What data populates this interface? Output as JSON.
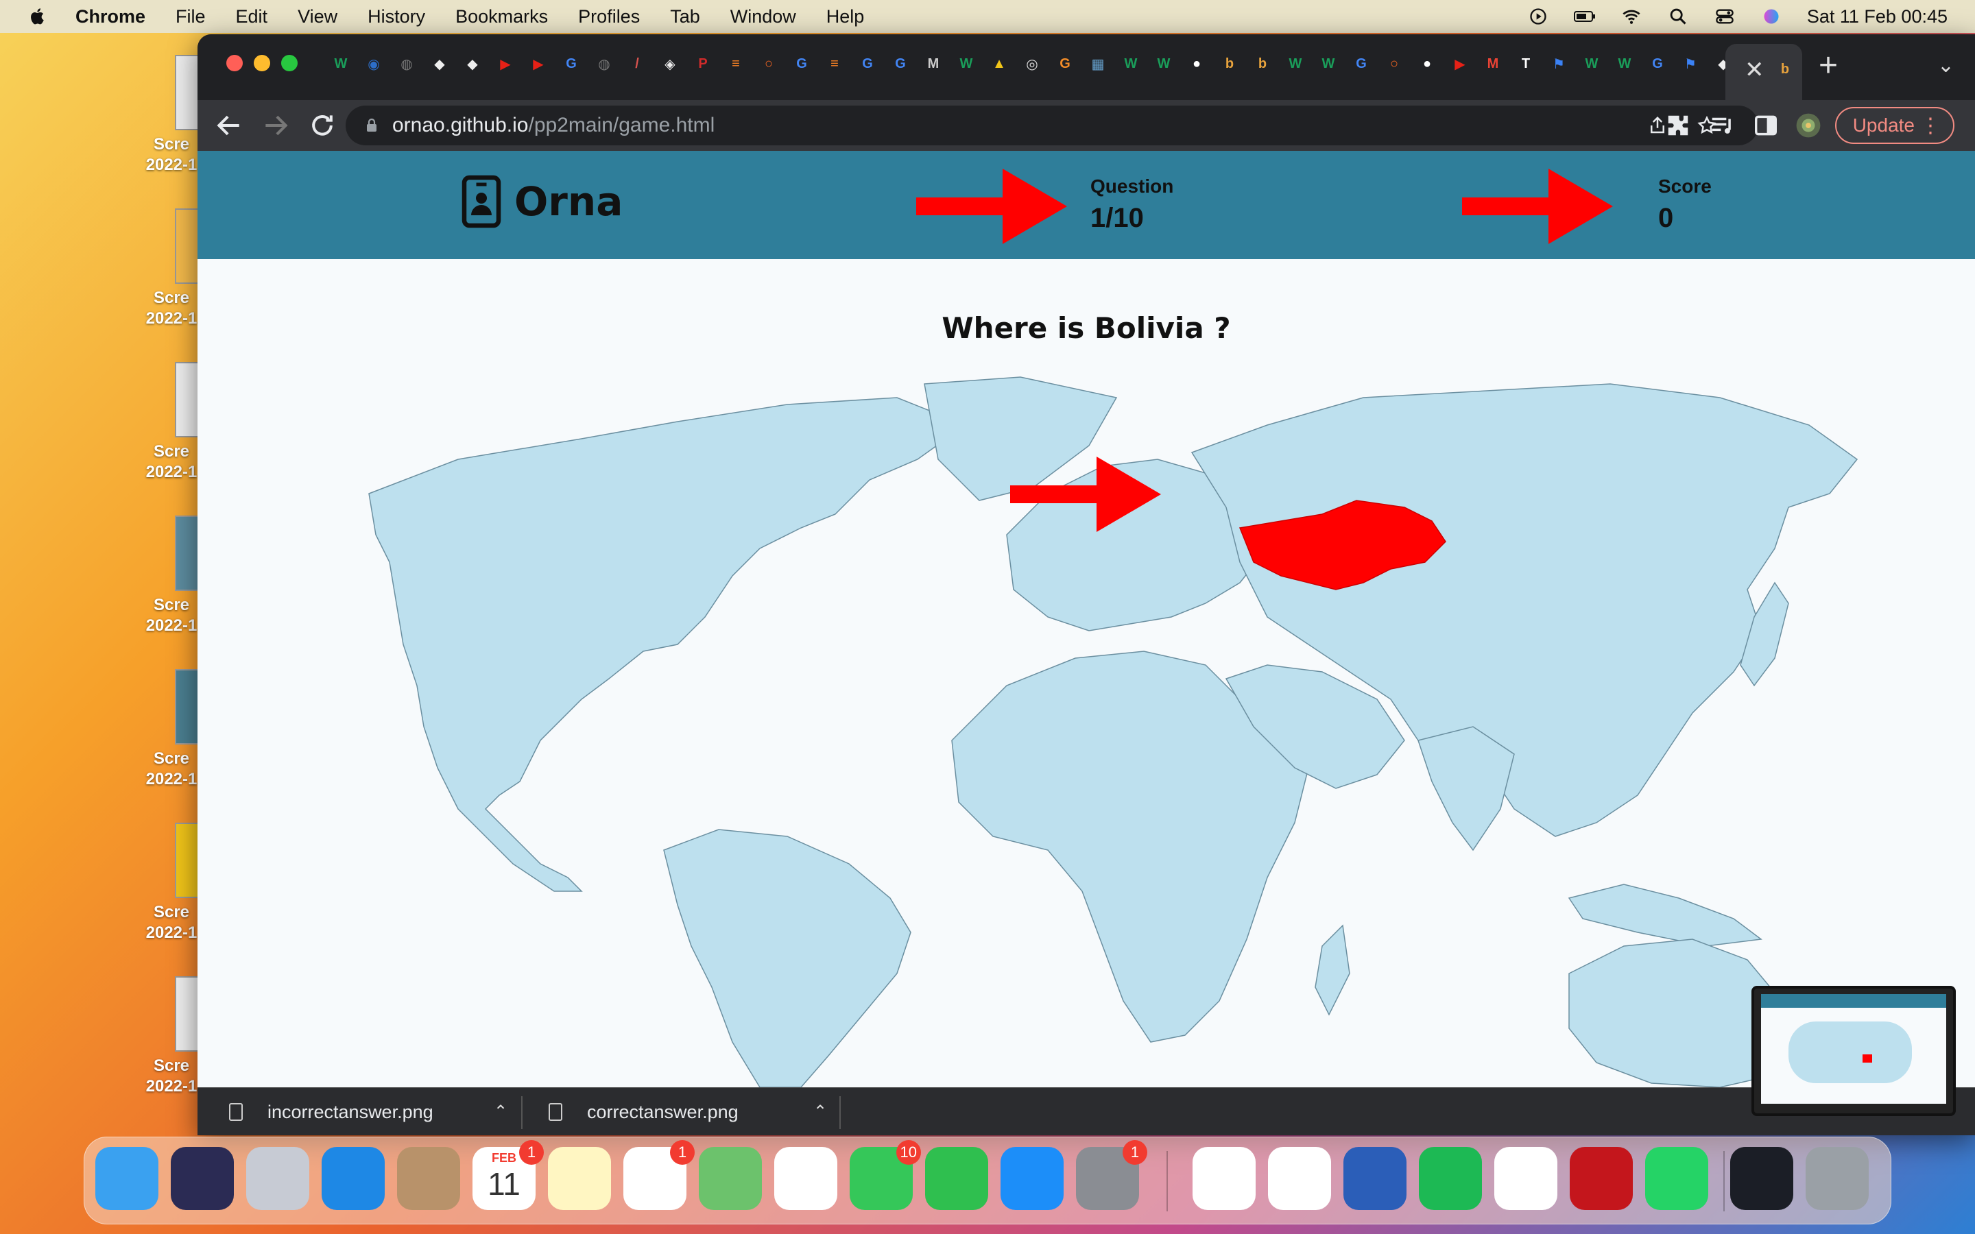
{
  "menubar": {
    "app_name": "Chrome",
    "items": [
      "File",
      "Edit",
      "View",
      "History",
      "Bookmarks",
      "Profiles",
      "Tab",
      "Window",
      "Help"
    ],
    "clock": "Sat 11 Feb  00:45"
  },
  "desktop": {
    "items": [
      {
        "label": "Scre",
        "sublabel": "2022-1"
      },
      {
        "label": "Scre",
        "sublabel": "2022-1"
      },
      {
        "label": "Scre",
        "sublabel": "2022-1"
      },
      {
        "label": "Scre",
        "sublabel": "2022-1"
      },
      {
        "label": "Scre",
        "sublabel": "2022-1"
      },
      {
        "label": "Scre",
        "sublabel": "2022-1"
      },
      {
        "label": "Scre",
        "sublabel": "2022-1"
      }
    ]
  },
  "browser": {
    "tab_favicons": [
      {
        "glyph": "W",
        "color": "#1a9e5a"
      },
      {
        "glyph": "◉",
        "color": "#2d6ec8"
      },
      {
        "glyph": "◍",
        "color": "#777777"
      },
      {
        "glyph": "◆",
        "color": "#eeeeee"
      },
      {
        "glyph": "◆",
        "color": "#eeeeee"
      },
      {
        "glyph": "▶",
        "color": "#e62117"
      },
      {
        "glyph": "▶",
        "color": "#e62117"
      },
      {
        "glyph": "G",
        "color": "#4285f4"
      },
      {
        "glyph": "◍",
        "color": "#777777"
      },
      {
        "glyph": "/",
        "color": "#d9534f"
      },
      {
        "glyph": "◈",
        "color": "#eeeeee"
      },
      {
        "glyph": "P",
        "color": "#d02b2b"
      },
      {
        "glyph": "≡",
        "color": "#f48024"
      },
      {
        "glyph": "○",
        "color": "#f26522"
      },
      {
        "glyph": "G",
        "color": "#4285f4"
      },
      {
        "glyph": "≡",
        "color": "#f48024"
      },
      {
        "glyph": "G",
        "color": "#4285f4"
      },
      {
        "glyph": "G",
        "color": "#4285f4"
      },
      {
        "glyph": "M",
        "color": "#cccccc"
      },
      {
        "glyph": "W",
        "color": "#1a9e5a"
      },
      {
        "glyph": "▲",
        "color": "#f0c419"
      },
      {
        "glyph": "◎",
        "color": "#dddddd"
      },
      {
        "glyph": "G",
        "color": "#f28c28"
      },
      {
        "glyph": "▦",
        "color": "#6aa9d8"
      },
      {
        "glyph": "W",
        "color": "#1a9e5a"
      },
      {
        "glyph": "W",
        "color": "#1a9e5a"
      },
      {
        "glyph": "●",
        "color": "#ffffff"
      },
      {
        "glyph": "b",
        "color": "#e8a33d"
      },
      {
        "glyph": "b",
        "color": "#e8a33d"
      },
      {
        "glyph": "W",
        "color": "#1a9e5a"
      },
      {
        "glyph": "W",
        "color": "#1a9e5a"
      },
      {
        "glyph": "G",
        "color": "#4285f4"
      },
      {
        "glyph": "○",
        "color": "#f26522"
      },
      {
        "glyph": "●",
        "color": "#ffffff"
      },
      {
        "glyph": "▶",
        "color": "#e62117"
      },
      {
        "glyph": "M",
        "color": "#ea4335"
      },
      {
        "glyph": "T",
        "color": "#ffffff"
      },
      {
        "glyph": "⚑",
        "color": "#3b82f6"
      },
      {
        "glyph": "W",
        "color": "#1a9e5a"
      },
      {
        "glyph": "W",
        "color": "#1a9e5a"
      },
      {
        "glyph": "G",
        "color": "#4285f4"
      },
      {
        "glyph": "⚑",
        "color": "#3b82f6"
      },
      {
        "glyph": "◆",
        "color": "#eeeeee"
      }
    ],
    "active_tab_favicon": {
      "glyph": "b",
      "color": "#e8a33d"
    },
    "url_host": "ornao.github.io",
    "url_path": "/pp2main/game.html",
    "update_label": "Update"
  },
  "game": {
    "brand": "Orna",
    "question_label": "Question",
    "question_value": "1/10",
    "score_label": "Score",
    "score_value": "0",
    "prompt": "Where is Bolivia ?",
    "highlight_color": "#ff0000",
    "land_color": "#bde0ee",
    "header_color": "#2f7e9a",
    "arrow_color": "#ff0000"
  },
  "downloads": {
    "items": [
      {
        "name": "incorrectanswer.png"
      },
      {
        "name": "correctanswer.png"
      }
    ]
  },
  "dock": {
    "apps": [
      {
        "name": "Finder",
        "color": "#3aa1f0"
      },
      {
        "name": "Siri",
        "color": "#2b2b54"
      },
      {
        "name": "Launchpad",
        "color": "#c7cbd4"
      },
      {
        "name": "Safari",
        "color": "#1e88e5"
      },
      {
        "name": "Contacts",
        "color": "#b8926a"
      },
      {
        "name": "Calendar",
        "color": "#ffffff",
        "badge": "1",
        "text": "FEB",
        "day": "11"
      },
      {
        "name": "Notes",
        "color": "#fff6c2"
      },
      {
        "name": "Reminders",
        "color": "#ffffff",
        "badge": "1"
      },
      {
        "name": "Maps",
        "color": "#6cc26c"
      },
      {
        "name": "Photos",
        "color": "#ffffff"
      },
      {
        "name": "Messages",
        "color": "#35c759",
        "badge": "10"
      },
      {
        "name": "FaceTime",
        "color": "#2fbf4f"
      },
      {
        "name": "App Store",
        "color": "#1c8ef9"
      },
      {
        "name": "System Preferences",
        "color": "#8a8d93",
        "badge": "1"
      },
      {
        "name": "Chrome",
        "color": "#ffffff"
      },
      {
        "name": "Slack",
        "color": "#ffffff"
      },
      {
        "name": "Word",
        "color": "#2b5eb8"
      },
      {
        "name": "Spotify",
        "color": "#1db954"
      },
      {
        "name": "Character",
        "color": "#ffffff"
      },
      {
        "name": "Acrobat",
        "color": "#c4161c"
      },
      {
        "name": "WhatsApp",
        "color": "#25d366"
      },
      {
        "name": "Recent Window",
        "color": "#1b1e26"
      },
      {
        "name": "Trash",
        "color": "#9aa0a6"
      }
    ]
  }
}
